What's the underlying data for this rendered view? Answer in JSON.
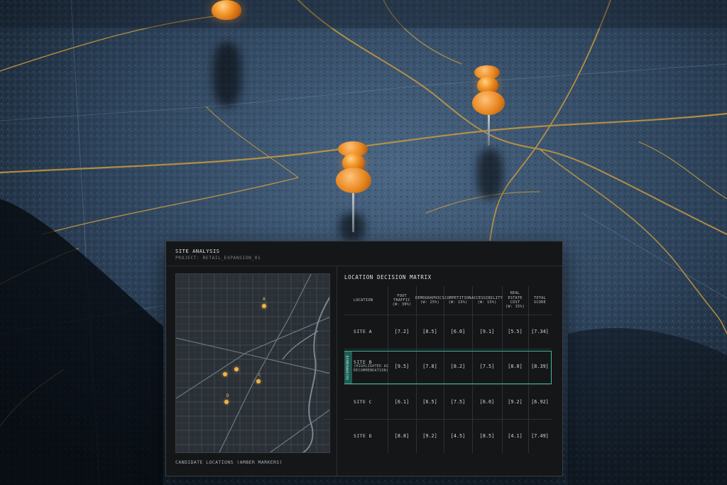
{
  "panel": {
    "title": "SITE ANALYSIS",
    "subtitle": "PROJECT: RETAIL_EXPANSION_01",
    "map_caption": "CANDIDATE LOCATIONS (AMBER MARKERS)",
    "map_marker_labels": [
      "A",
      "C",
      "D"
    ]
  },
  "matrix": {
    "title": "LOCATION DECISION MATRIX",
    "headers": {
      "location": "LOCATION",
      "foot_traffic": [
        "FOOT",
        "TRAFFIC",
        "(W: 30%)"
      ],
      "demographics": [
        "DEMOGRAPHICS",
        "(W: 25%)"
      ],
      "competition": [
        "COMPETITION",
        "(W: 15%)"
      ],
      "accessibility": [
        "ACCESSIBILITY",
        "(W: 15%)"
      ],
      "real_estate_cost": [
        "REAL",
        "ESTATE",
        "COST",
        "(W: 15%)"
      ],
      "total_score": [
        "TOTAL",
        "SCORE"
      ]
    },
    "rows": [
      {
        "location": "SITE A",
        "note": "",
        "values": [
          "[7.2]",
          "[8.5]",
          "[6.0]",
          "[9.1]",
          "[5.5]",
          "[7.34]"
        ]
      },
      {
        "location": "SITE B",
        "note": "(HIGHLIGHTED AS RECOMMENDATION)",
        "values": [
          "[9.5]",
          "[7.8]",
          "[8.2]",
          "[7.5]",
          "[8.0]",
          "[8.39]"
        ]
      },
      {
        "location": "SITE C",
        "note": "",
        "values": [
          "[6.1]",
          "[6.5]",
          "[7.5]",
          "[6.0]",
          "[9.2]",
          "[6.92]"
        ]
      },
      {
        "location": "SITE D",
        "note": "",
        "values": [
          "[8.8]",
          "[9.2]",
          "[4.5]",
          "[8.5]",
          "[4.1]",
          "[7.49]"
        ]
      }
    ],
    "recommended_tag": "RECOMMENDED",
    "accent_color": "#3fb9a0"
  },
  "colors": {
    "marker": "#f0b347",
    "road": "#c99a3e",
    "panel_bg": "#141617"
  },
  "icons": [
    "pushpin-icon",
    "map-marker-icon"
  ]
}
